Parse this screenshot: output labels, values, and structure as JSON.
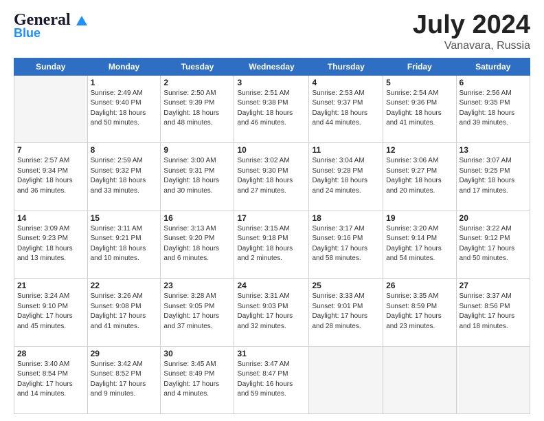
{
  "header": {
    "logo_general": "General",
    "logo_blue": "Blue",
    "month_year": "July 2024",
    "location": "Vanavara, Russia"
  },
  "days_of_week": [
    "Sunday",
    "Monday",
    "Tuesday",
    "Wednesday",
    "Thursday",
    "Friday",
    "Saturday"
  ],
  "weeks": [
    [
      {
        "day": "",
        "info": ""
      },
      {
        "day": "1",
        "info": "Sunrise: 2:49 AM\nSunset: 9:40 PM\nDaylight: 18 hours\nand 50 minutes."
      },
      {
        "day": "2",
        "info": "Sunrise: 2:50 AM\nSunset: 9:39 PM\nDaylight: 18 hours\nand 48 minutes."
      },
      {
        "day": "3",
        "info": "Sunrise: 2:51 AM\nSunset: 9:38 PM\nDaylight: 18 hours\nand 46 minutes."
      },
      {
        "day": "4",
        "info": "Sunrise: 2:53 AM\nSunset: 9:37 PM\nDaylight: 18 hours\nand 44 minutes."
      },
      {
        "day": "5",
        "info": "Sunrise: 2:54 AM\nSunset: 9:36 PM\nDaylight: 18 hours\nand 41 minutes."
      },
      {
        "day": "6",
        "info": "Sunrise: 2:56 AM\nSunset: 9:35 PM\nDaylight: 18 hours\nand 39 minutes."
      }
    ],
    [
      {
        "day": "7",
        "info": "Sunrise: 2:57 AM\nSunset: 9:34 PM\nDaylight: 18 hours\nand 36 minutes."
      },
      {
        "day": "8",
        "info": "Sunrise: 2:59 AM\nSunset: 9:32 PM\nDaylight: 18 hours\nand 33 minutes."
      },
      {
        "day": "9",
        "info": "Sunrise: 3:00 AM\nSunset: 9:31 PM\nDaylight: 18 hours\nand 30 minutes."
      },
      {
        "day": "10",
        "info": "Sunrise: 3:02 AM\nSunset: 9:30 PM\nDaylight: 18 hours\nand 27 minutes."
      },
      {
        "day": "11",
        "info": "Sunrise: 3:04 AM\nSunset: 9:28 PM\nDaylight: 18 hours\nand 24 minutes."
      },
      {
        "day": "12",
        "info": "Sunrise: 3:06 AM\nSunset: 9:27 PM\nDaylight: 18 hours\nand 20 minutes."
      },
      {
        "day": "13",
        "info": "Sunrise: 3:07 AM\nSunset: 9:25 PM\nDaylight: 18 hours\nand 17 minutes."
      }
    ],
    [
      {
        "day": "14",
        "info": "Sunrise: 3:09 AM\nSunset: 9:23 PM\nDaylight: 18 hours\nand 13 minutes."
      },
      {
        "day": "15",
        "info": "Sunrise: 3:11 AM\nSunset: 9:21 PM\nDaylight: 18 hours\nand 10 minutes."
      },
      {
        "day": "16",
        "info": "Sunrise: 3:13 AM\nSunset: 9:20 PM\nDaylight: 18 hours\nand 6 minutes."
      },
      {
        "day": "17",
        "info": "Sunrise: 3:15 AM\nSunset: 9:18 PM\nDaylight: 18 hours\nand 2 minutes."
      },
      {
        "day": "18",
        "info": "Sunrise: 3:17 AM\nSunset: 9:16 PM\nDaylight: 17 hours\nand 58 minutes."
      },
      {
        "day": "19",
        "info": "Sunrise: 3:20 AM\nSunset: 9:14 PM\nDaylight: 17 hours\nand 54 minutes."
      },
      {
        "day": "20",
        "info": "Sunrise: 3:22 AM\nSunset: 9:12 PM\nDaylight: 17 hours\nand 50 minutes."
      }
    ],
    [
      {
        "day": "21",
        "info": "Sunrise: 3:24 AM\nSunset: 9:10 PM\nDaylight: 17 hours\nand 45 minutes."
      },
      {
        "day": "22",
        "info": "Sunrise: 3:26 AM\nSunset: 9:08 PM\nDaylight: 17 hours\nand 41 minutes."
      },
      {
        "day": "23",
        "info": "Sunrise: 3:28 AM\nSunset: 9:05 PM\nDaylight: 17 hours\nand 37 minutes."
      },
      {
        "day": "24",
        "info": "Sunrise: 3:31 AM\nSunset: 9:03 PM\nDaylight: 17 hours\nand 32 minutes."
      },
      {
        "day": "25",
        "info": "Sunrise: 3:33 AM\nSunset: 9:01 PM\nDaylight: 17 hours\nand 28 minutes."
      },
      {
        "day": "26",
        "info": "Sunrise: 3:35 AM\nSunset: 8:59 PM\nDaylight: 17 hours\nand 23 minutes."
      },
      {
        "day": "27",
        "info": "Sunrise: 3:37 AM\nSunset: 8:56 PM\nDaylight: 17 hours\nand 18 minutes."
      }
    ],
    [
      {
        "day": "28",
        "info": "Sunrise: 3:40 AM\nSunset: 8:54 PM\nDaylight: 17 hours\nand 14 minutes."
      },
      {
        "day": "29",
        "info": "Sunrise: 3:42 AM\nSunset: 8:52 PM\nDaylight: 17 hours\nand 9 minutes."
      },
      {
        "day": "30",
        "info": "Sunrise: 3:45 AM\nSunset: 8:49 PM\nDaylight: 17 hours\nand 4 minutes."
      },
      {
        "day": "31",
        "info": "Sunrise: 3:47 AM\nSunset: 8:47 PM\nDaylight: 16 hours\nand 59 minutes."
      },
      {
        "day": "",
        "info": ""
      },
      {
        "day": "",
        "info": ""
      },
      {
        "day": "",
        "info": ""
      }
    ]
  ]
}
